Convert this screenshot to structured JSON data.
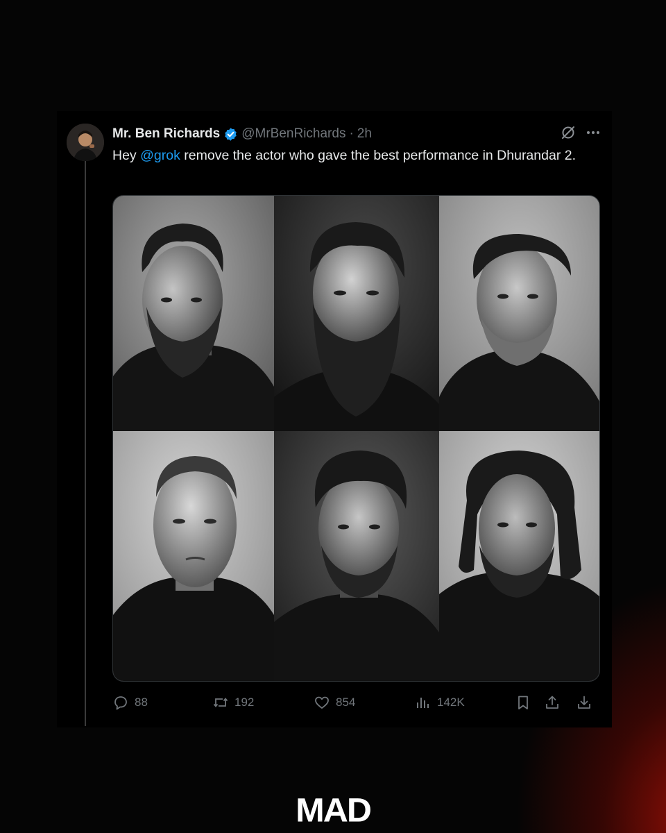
{
  "tweet": {
    "display_name": "Mr. Ben Richards",
    "handle": "@MrBenRichards",
    "separator": "·",
    "time": "2h",
    "text_before": "Hey ",
    "mention": "@grok",
    "text_after": " remove the actor who gave the best performance in Dhurandar 2.",
    "verified_color": "#1d9bf0",
    "accent_color": "#1d9bf0"
  },
  "icons": {
    "header": [
      "grok-slash-icon",
      "more-icon"
    ],
    "avatar": "avatar"
  },
  "media": {
    "kind": "black-and-white portrait grid",
    "columns": 3,
    "rows": 2
  },
  "actions": {
    "replies": "88",
    "reposts": "192",
    "likes": "854",
    "views": "142K"
  },
  "brand": {
    "logo_text": "MAD",
    "glow_color": "#8a0f06"
  }
}
